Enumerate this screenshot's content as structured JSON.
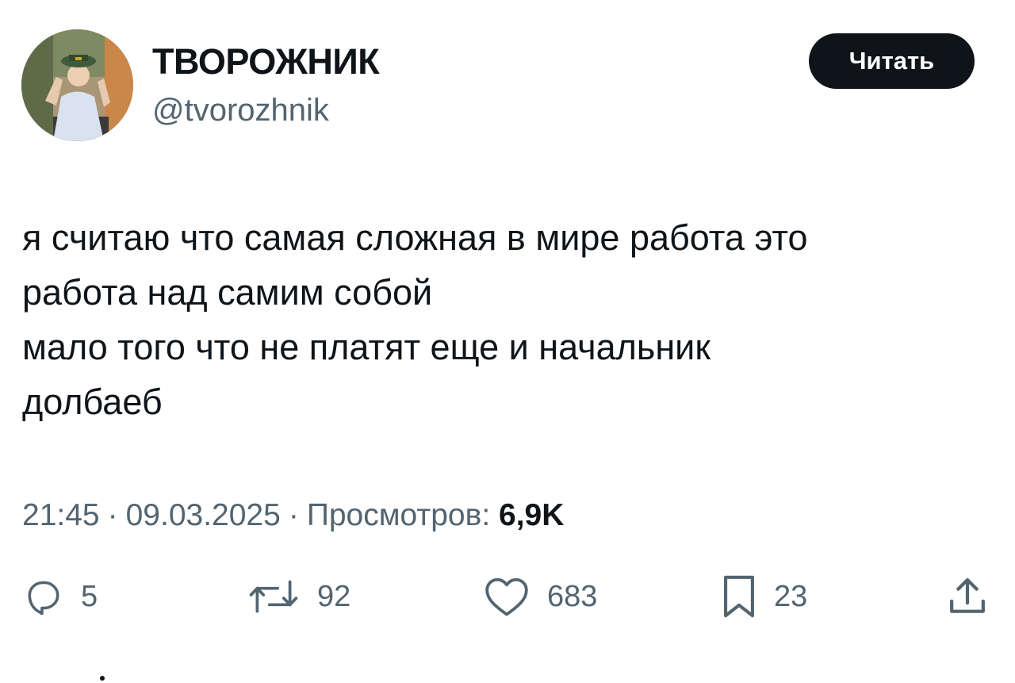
{
  "author": {
    "display_name": "ТВОРОЖНИК",
    "handle": "@tvorozhnik"
  },
  "follow_button": {
    "label": "Читать"
  },
  "tweet": {
    "lines": [
      "я считаю что самая сложная в мире работа это",
      "работа над самим собой",
      "мало того что не платят еще и начальник",
      "долбаеб"
    ]
  },
  "meta": {
    "time": "21:45",
    "date": "09.03.2025",
    "separator": "·",
    "views_label": "Просмотров:",
    "views_count": "6,9K"
  },
  "actions": {
    "replies": {
      "icon": "reply-icon",
      "count": "5"
    },
    "retweets": {
      "icon": "retweet-icon",
      "count": "92"
    },
    "likes": {
      "icon": "heart-icon",
      "count": "683"
    },
    "bookmarks": {
      "icon": "bookmark-icon",
      "count": "23"
    },
    "share": {
      "icon": "share-icon"
    }
  },
  "colors": {
    "text_primary": "#0f1419",
    "text_secondary": "#536471",
    "follow_button_bg": "#0f1419",
    "background": "#ffffff"
  }
}
